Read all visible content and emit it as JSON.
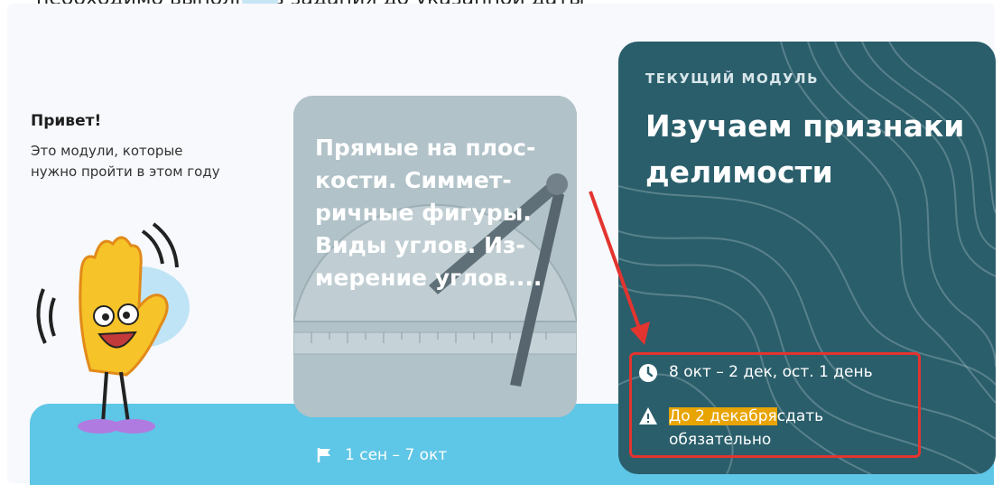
{
  "top_text": "необходимо выполнить задания до указанной даты",
  "greeting": {
    "title": "Привет!",
    "text": "Это модули, которые нужно пройти в этом году"
  },
  "previous_module": {
    "title": "Прямые на плос­кости. Симмет­ричные фигуры. Виды углов. Из­мерение углов....",
    "dates": "1 сен – 7 окт"
  },
  "current_module": {
    "label": "ТЕКУЩИЙ МОДУЛЬ",
    "title": "Изучаем призна­ки делимости",
    "dates": "8 окт – 2 дек, ост. 1 день",
    "deadline_highlight": "До 2 декабря",
    "deadline_rest": "сдать обязательно"
  },
  "colors": {
    "current_card": "#2a5e6b",
    "band": "#5ec6e6",
    "highlight": "#e8a400",
    "annotation": "#e3342f"
  },
  "icons": [
    "clock-icon",
    "warning-icon",
    "flag-icon"
  ]
}
